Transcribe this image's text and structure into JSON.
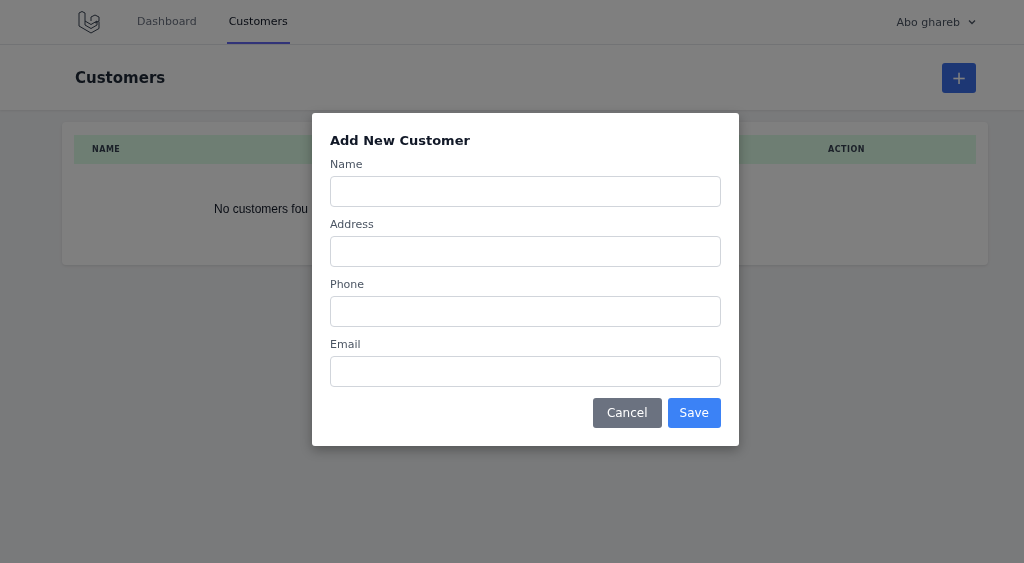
{
  "nav": {
    "links": [
      {
        "label": "Dashboard",
        "selected": false
      },
      {
        "label": "Customers",
        "selected": true
      }
    ],
    "user": "Abo ghareb"
  },
  "header": {
    "title": "Customers",
    "add_button": "+"
  },
  "table": {
    "columns": [
      "NAME",
      "ACTION"
    ],
    "empty_message": "No customers fou"
  },
  "modal": {
    "title": "Add New Customer",
    "fields": [
      {
        "label": "Name"
      },
      {
        "label": "Address"
      },
      {
        "label": "Phone"
      },
      {
        "label": "Email"
      }
    ],
    "buttons": [
      {
        "label": "Cancel",
        "kind": "secondary"
      },
      {
        "label": "Save",
        "kind": "primary"
      }
    ]
  }
}
